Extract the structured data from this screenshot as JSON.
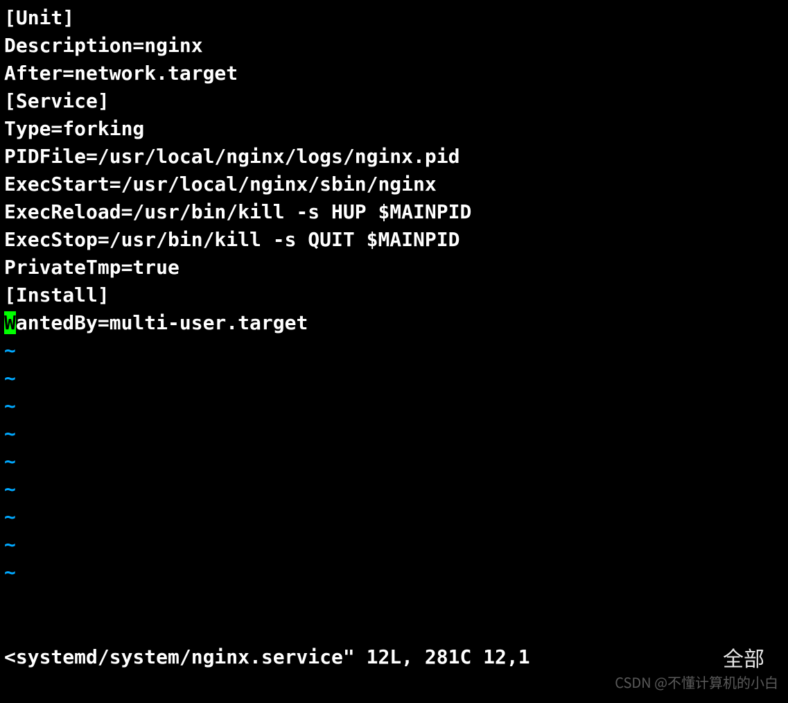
{
  "editor": {
    "lines": [
      "[Unit]",
      "Description=nginx",
      "After=network.target",
      "[Service]",
      "Type=forking",
      "PIDFile=/usr/local/nginx/logs/nginx.pid",
      "ExecStart=/usr/local/nginx/sbin/nginx",
      "ExecReload=/usr/bin/kill -s HUP $MAINPID",
      "ExecStop=/usr/bin/kill -s QUIT $MAINPID",
      "PrivateTmp=true",
      "[Install]",
      "WantedBy=multi-user.target"
    ],
    "cursor": {
      "line_index": 11,
      "col": 0
    },
    "tilde_rows": 9,
    "tilde_char": "~"
  },
  "status": {
    "left": "<systemd/system/nginx.service\" 12L, 281C 12,1",
    "right": "全部"
  },
  "watermark": "CSDN @不懂计算机的小白"
}
